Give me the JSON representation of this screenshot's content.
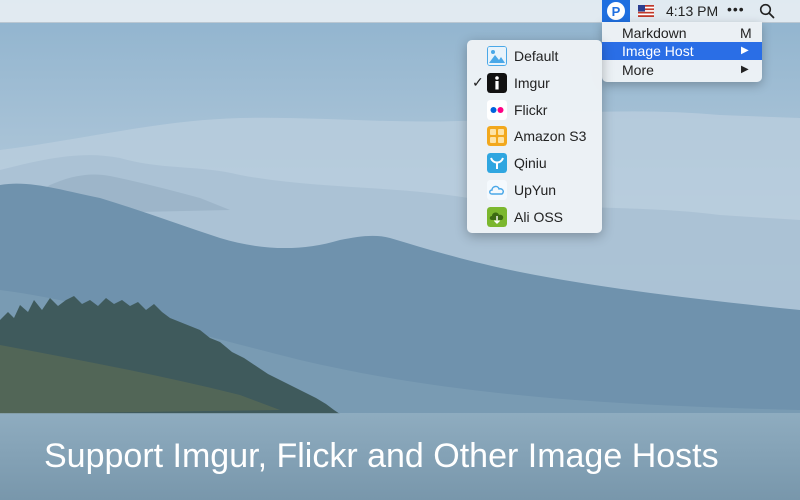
{
  "menubar": {
    "app_icon_letter": "P",
    "time": "4:13 PM",
    "more_glyph": "•••"
  },
  "main_menu": {
    "items": [
      {
        "label": "Markdown",
        "shortcut": "M",
        "submenu": false,
        "selected": false
      },
      {
        "label": "Image Host",
        "shortcut": "",
        "submenu": true,
        "selected": true
      },
      {
        "label": "More",
        "shortcut": "",
        "submenu": true,
        "selected": false
      }
    ],
    "submenu_arrow": "▶"
  },
  "image_host_menu": {
    "check_glyph": "✓",
    "items": [
      {
        "label": "Default",
        "icon": "image-icon",
        "checked": false
      },
      {
        "label": "Imgur",
        "icon": "imgur-icon",
        "checked": true
      },
      {
        "label": "Flickr",
        "icon": "flickr-icon",
        "checked": false
      },
      {
        "label": "Amazon S3",
        "icon": "amazon-s3-icon",
        "checked": false
      },
      {
        "label": "Qiniu",
        "icon": "qiniu-icon",
        "checked": false
      },
      {
        "label": "UpYun",
        "icon": "cloud-icon",
        "checked": false
      },
      {
        "label": "Ali OSS",
        "icon": "ali-oss-icon",
        "checked": false
      }
    ]
  },
  "caption": "Support Imgur, Flickr and Other Image Hosts",
  "colors": {
    "accent": "#2a6ee6",
    "app_icon": "#1f6fe0",
    "flickr_blue": "#0063dc",
    "flickr_pink": "#ff0084",
    "s3_orange": "#f2a81d",
    "qiniu_blue": "#2fa6e0",
    "upyun_blue": "#4aa8e8",
    "ali_green": "#7bb72e"
  }
}
